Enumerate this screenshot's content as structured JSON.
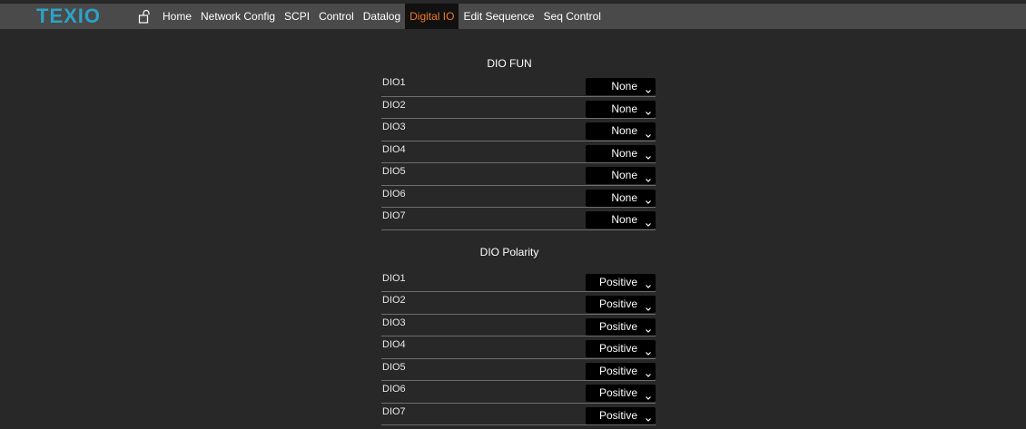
{
  "header": {
    "logo_text": "TEXIO",
    "logo_color": "#2ba3c7",
    "nav_items": [
      {
        "label": "Home",
        "active": false
      },
      {
        "label": "Network Config",
        "active": false
      },
      {
        "label": "SCPI",
        "active": false
      },
      {
        "label": "Control",
        "active": false
      },
      {
        "label": "Datalog",
        "active": false
      },
      {
        "label": "Digital IO",
        "active": true
      },
      {
        "label": "Edit Sequence",
        "active": false
      },
      {
        "label": "Seq Control",
        "active": false
      }
    ],
    "active_color": "#f07a2a",
    "lock_icon": "unlocked-padlock-icon"
  },
  "dio_fun": {
    "title": "DIO FUN",
    "rows": [
      {
        "label": "DIO1",
        "value": "None"
      },
      {
        "label": "DIO2",
        "value": "None"
      },
      {
        "label": "DIO3",
        "value": "None"
      },
      {
        "label": "DIO4",
        "value": "None"
      },
      {
        "label": "DIO5",
        "value": "None"
      },
      {
        "label": "DIO6",
        "value": "None"
      },
      {
        "label": "DIO7",
        "value": "None"
      }
    ]
  },
  "dio_polarity": {
    "title": "DIO Polarity",
    "rows": [
      {
        "label": "DIO1",
        "value": "Positive"
      },
      {
        "label": "DIO2",
        "value": "Positive"
      },
      {
        "label": "DIO3",
        "value": "Positive"
      },
      {
        "label": "DIO4",
        "value": "Positive"
      },
      {
        "label": "DIO5",
        "value": "Positive"
      },
      {
        "label": "DIO6",
        "value": "Positive"
      },
      {
        "label": "DIO7",
        "value": "Positive"
      }
    ]
  }
}
